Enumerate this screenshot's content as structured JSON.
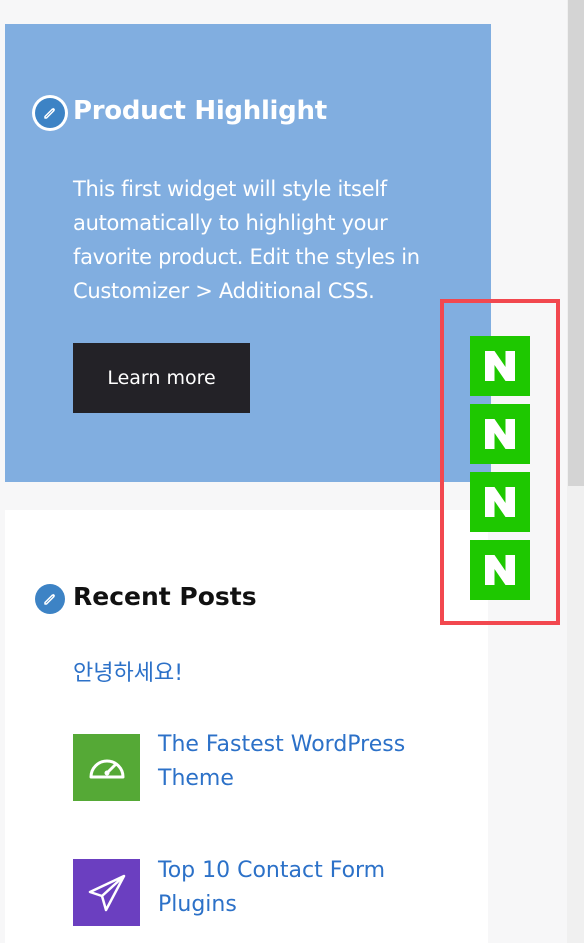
{
  "highlight_widget": {
    "title": "Product Highlight",
    "description": "This first widget will style itself automatically to highlight your favorite product. Edit the styles in Customizer > Additional CSS.",
    "button_label": "Learn more",
    "background_color": "#81aee0"
  },
  "recent_posts": {
    "title": "Recent Posts",
    "posts": [
      {
        "title": "안녕하세요!",
        "thumb": null
      },
      {
        "title": "The Fastest WordPress Theme",
        "thumb": "speedometer-icon",
        "thumb_color": "#55a936"
      },
      {
        "title": "Top 10 Contact Form Plugins",
        "thumb": "paper-plane-icon",
        "thumb_color": "#6b3fc0"
      }
    ]
  },
  "floating_icons": {
    "icon": "naver-n-icon",
    "letter": "N",
    "count": 4,
    "color": "#1ec800",
    "highlight_border_color": "#f2484f"
  },
  "colors": {
    "link": "#2c71c8",
    "edit_badge": "#3d83c5",
    "button_bg": "#232227"
  }
}
